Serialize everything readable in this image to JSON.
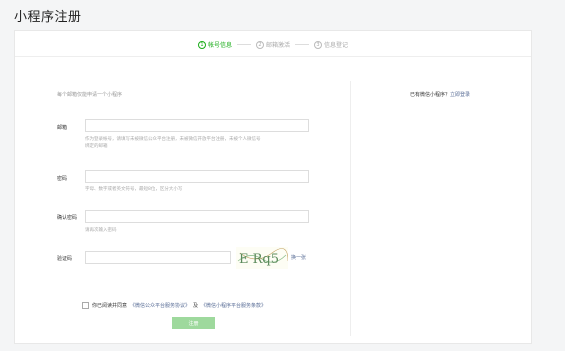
{
  "page": {
    "title": "小程序注册"
  },
  "steps": [
    {
      "num": "1",
      "label": "帐号信息"
    },
    {
      "num": "2",
      "label": "邮箱激活"
    },
    {
      "num": "3",
      "label": "信息登记"
    }
  ],
  "form": {
    "intro": "每个邮箱仅能申请一个小程序",
    "email": {
      "label": "邮箱",
      "value": "",
      "hint1": "作为登录帐号，请填写未被微信公众平台注册，未被微信开放平台注册，未被个人微信号",
      "hint2": "绑定的邮箱"
    },
    "password": {
      "label": "密码",
      "value": "",
      "hint": "字母、数字或者英文符号，最短8位，区分大小写"
    },
    "confirm": {
      "label": "确认密码",
      "value": "",
      "hint": "请再次输入密码"
    },
    "captcha": {
      "label": "验证码",
      "value": "",
      "image_text": "E Rq5",
      "refresh": "换一张"
    },
    "agreement": {
      "prefix": "你已阅读并同意",
      "link1": "《微信公众平台服务协议》",
      "middle": "及",
      "link2": "《微信小程序平台服务条款》"
    },
    "submit": "注册"
  },
  "sidebar": {
    "login_prompt": "已有微信小程序？",
    "login_link": "立即登录"
  },
  "colors": {
    "accent": "#1aad19",
    "button_disabled": "#9ed99d",
    "link": "#576b95"
  }
}
